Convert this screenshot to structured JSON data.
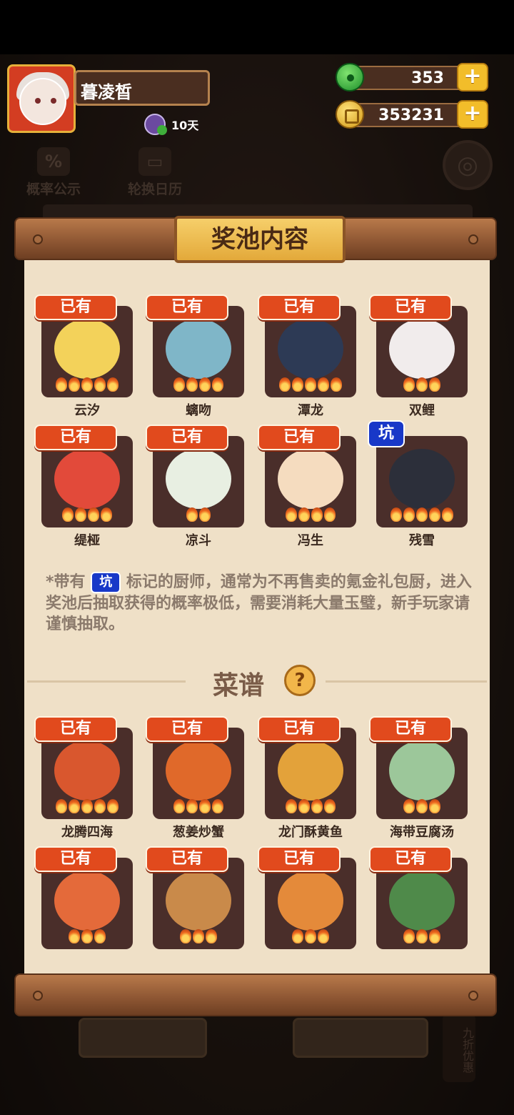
{
  "player": {
    "name": "暮凌皙",
    "days": "10天"
  },
  "currencies": {
    "jade": {
      "value": "353",
      "icon": "jade-icon"
    },
    "coin": {
      "value": "353231",
      "icon": "coin-icon"
    }
  },
  "background": {
    "prob_button": "概率公示",
    "calendar_button": "轮换日历",
    "side_button": "九折优惠"
  },
  "panel": {
    "title": "奖池内容",
    "owned_label": "已有",
    "pit_label": "坑",
    "chefs": [
      {
        "name": "云汐",
        "owned": true,
        "stars": 5,
        "color": "#f3d25a"
      },
      {
        "name": "螭吻",
        "owned": true,
        "stars": 4,
        "color": "#7fb6c8"
      },
      {
        "name": "潭龙",
        "owned": true,
        "stars": 5,
        "color": "#2d3a55"
      },
      {
        "name": "双鲤",
        "owned": true,
        "stars": 3,
        "color": "#f1ecec"
      },
      {
        "name": "缇桠",
        "owned": true,
        "stars": 4,
        "color": "#e24a3a"
      },
      {
        "name": "凉斗",
        "owned": true,
        "stars": 2,
        "color": "#e8efe2"
      },
      {
        "name": "冯生",
        "owned": true,
        "stars": 4,
        "color": "#f5dcbf"
      },
      {
        "name": "残雪",
        "owned": false,
        "pit": true,
        "stars": 5,
        "color": "#2c2f3a"
      }
    ],
    "note_prefix": "*带有",
    "note_suffix": "标记的厨师，通常为不再售卖的氪金礼包厨，进入奖池后抽取获得的概率极低，需要消耗大量玉璧，新手玩家请谨慎抽取。",
    "recipes_title": "菜谱",
    "recipes": [
      {
        "name": "龙腾四海",
        "owned": true,
        "stars": 5,
        "color": "#d9572e"
      },
      {
        "name": "葱姜炒蟹",
        "owned": true,
        "stars": 4,
        "color": "#e0692a"
      },
      {
        "name": "龙门酥黄鱼",
        "owned": true,
        "stars": 4,
        "color": "#e3a23a"
      },
      {
        "name": "海带豆腐汤",
        "owned": true,
        "stars": 3,
        "color": "#9cc79a"
      },
      {
        "name": "",
        "owned": true,
        "stars": 3,
        "color": "#e46a3a"
      },
      {
        "name": "",
        "owned": true,
        "stars": 3,
        "color": "#c98a4a"
      },
      {
        "name": "",
        "owned": true,
        "stars": 3,
        "color": "#e48a3a"
      },
      {
        "name": "",
        "owned": true,
        "stars": 3,
        "color": "#4f8a4a"
      }
    ]
  }
}
